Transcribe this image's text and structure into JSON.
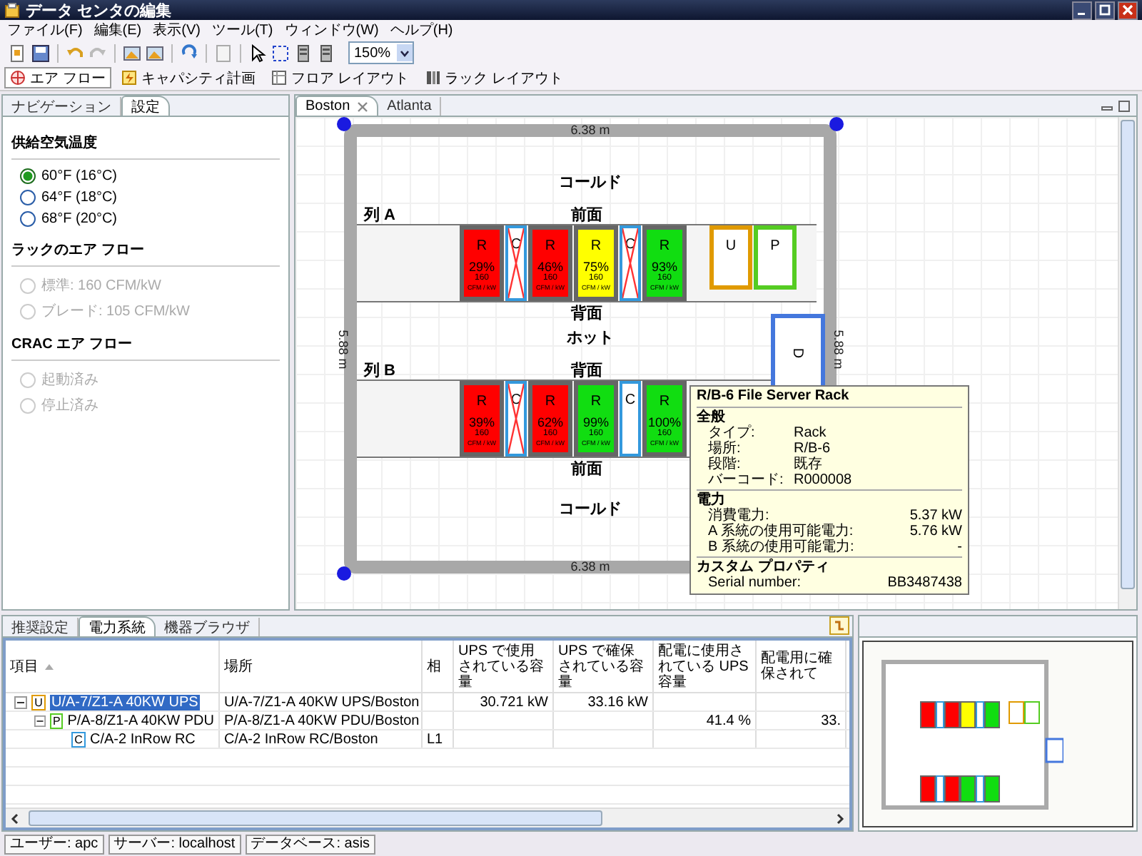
{
  "window": {
    "title": "データ センタの編集"
  },
  "menu": [
    "ファイル(F)",
    "編集(E)",
    "表示(V)",
    "ツール(T)",
    "ウィンドウ(W)",
    "ヘルプ(H)"
  ],
  "toolbar": {
    "zoom": "150%"
  },
  "perspectives": [
    {
      "label": "エア フロー",
      "selected": true
    },
    {
      "label": "キャパシティ計画",
      "selected": false
    },
    {
      "label": "フロア レイアウト",
      "selected": false
    },
    {
      "label": "ラック レイアウト",
      "selected": false
    }
  ],
  "left_panel": {
    "tabs": [
      {
        "label": "ナビゲーション",
        "selected": false
      },
      {
        "label": "設定",
        "selected": true
      }
    ],
    "sections": [
      {
        "title": "供給空気温度",
        "options": [
          {
            "label": "60°F (16°C)",
            "selected": true,
            "disabled": false
          },
          {
            "label": "64°F (18°C)",
            "selected": false,
            "disabled": false
          },
          {
            "label": "68°F (20°C)",
            "selected": false,
            "disabled": false
          }
        ]
      },
      {
        "title": "ラックのエア フロー",
        "options": [
          {
            "label": "標準: 160 CFM/kW",
            "selected": false,
            "disabled": true
          },
          {
            "label": "ブレード: 105 CFM/kW",
            "selected": false,
            "disabled": true
          }
        ]
      },
      {
        "title": "CRAC エア フロー",
        "options": [
          {
            "label": "起動済み",
            "selected": false,
            "disabled": true
          },
          {
            "label": "停止済み",
            "selected": false,
            "disabled": true
          }
        ]
      }
    ]
  },
  "editor": {
    "tabs": [
      {
        "label": "Boston",
        "selected": true,
        "closable": true
      },
      {
        "label": "Atlanta",
        "selected": false,
        "closable": false
      }
    ]
  },
  "floor_plan": {
    "width_top": "6.38 m",
    "width_bottom": "6.38 m",
    "depth_left": "5.88 m",
    "depth_right": "5.88 m",
    "layout": [
      {
        "kind": "aisle",
        "label": "コールド"
      },
      {
        "kind": "row",
        "label": "列 A",
        "top_label": "前面",
        "bottom_label": "背面",
        "units": [
          {
            "kind": "rack",
            "letter": "R",
            "percent": "29%",
            "airflow": "160",
            "airflow_unit": "CFM / kW",
            "color": "#ff0000"
          },
          {
            "kind": "cooler",
            "letter": "C",
            "disabled": true
          },
          {
            "kind": "rack",
            "letter": "R",
            "percent": "46%",
            "airflow": "160",
            "airflow_unit": "CFM / kW",
            "color": "#ff0000"
          },
          {
            "kind": "rack",
            "letter": "R",
            "percent": "75%",
            "airflow": "160",
            "airflow_unit": "CFM / kW",
            "color": "#ffff00"
          },
          {
            "kind": "cooler",
            "letter": "C",
            "disabled": true
          },
          {
            "kind": "rack",
            "letter": "R",
            "percent": "93%",
            "airflow": "160",
            "airflow_unit": "CFM / kW",
            "color": "#11dd11"
          },
          {
            "kind": "power",
            "letter": "U",
            "color": "#e09a00"
          },
          {
            "kind": "power",
            "letter": "P",
            "color": "#55cc22"
          }
        ]
      },
      {
        "kind": "aisle",
        "label": "ホット"
      },
      {
        "kind": "row",
        "label": "列 B",
        "top_label": "背面",
        "bottom_label": "前面",
        "units": [
          {
            "kind": "rack",
            "letter": "R",
            "percent": "39%",
            "airflow": "160",
            "airflow_unit": "CFM / kW",
            "color": "#ff0000"
          },
          {
            "kind": "cooler",
            "letter": "C",
            "disabled": true
          },
          {
            "kind": "rack",
            "letter": "R",
            "percent": "62%",
            "airflow": "160",
            "airflow_unit": "CFM / kW",
            "color": "#ff0000"
          },
          {
            "kind": "rack",
            "letter": "R",
            "percent": "99%",
            "airflow": "160",
            "airflow_unit": "CFM / kW",
            "color": "#11dd11"
          },
          {
            "kind": "cooler",
            "letter": "C",
            "disabled": false
          },
          {
            "kind": "rack",
            "letter": "R",
            "percent": "100%",
            "airflow": "160",
            "airflow_unit": "CFM / kW",
            "color": "#11dd11"
          }
        ]
      },
      {
        "kind": "aisle",
        "label": "コールド"
      }
    ],
    "extra_unit": {
      "letter": "D"
    }
  },
  "tooltip": {
    "title": "R/B-6 File Server Rack",
    "sections": [
      {
        "title": "全般",
        "rows": [
          {
            "label": "タイプ:",
            "value": "Rack"
          },
          {
            "label": "場所:",
            "value": "R/B-6"
          },
          {
            "label": "段階:",
            "value": "既存"
          },
          {
            "label": "バーコード:",
            "value": "R000008"
          }
        ]
      },
      {
        "title": "電力",
        "rows": [
          {
            "label": "消費電力:",
            "value": "5.37 kW"
          },
          {
            "label": "A 系統の使用可能電力:",
            "value": "5.76 kW"
          },
          {
            "label": "B 系統の使用可能電力:",
            "value": "-"
          }
        ]
      },
      {
        "title": "カスタム プロパティ",
        "rows": [
          {
            "label": "Serial number:",
            "value": "BB3487438"
          }
        ]
      }
    ]
  },
  "bottom": {
    "tabs": [
      {
        "label": "推奨設定",
        "selected": false
      },
      {
        "label": "電力系統",
        "selected": true
      },
      {
        "label": "機器ブラウザ",
        "selected": false
      }
    ],
    "table": {
      "columns": [
        "項目",
        "場所",
        "相",
        "UPS で使用されている容量",
        "UPS で確保されている容量",
        "配電に使用されている UPS 容量",
        "配電用に確保されて"
      ],
      "rows": [
        {
          "badge": "U",
          "color": "#e09a00",
          "name": "U/A-7/Z1-A 40KW UPS",
          "selected": true,
          "expanded": true,
          "location": "U/A-7/Z1-A 40KW UPS/Boston",
          "ups_used": "30.721 kW",
          "ups_reserved": "33.16 kW",
          "children": [
            {
              "badge": "P",
              "color": "#55cc22",
              "name": "P/A-8/Z1-A 40KW PDU",
              "selected": false,
              "expanded": true,
              "location": "P/A-8/Z1-A 40KW PDU/Boston",
              "dist_used": "41.4 %",
              "dist_reserved": "33.",
              "children": [
                {
                  "badge": "C",
                  "color": "#3399dd",
                  "name": "C/A-2 InRow RC",
                  "selected": false,
                  "location": "C/A-2 InRow RC/Boston",
                  "phase": "L1"
                }
              ]
            }
          ]
        }
      ]
    }
  },
  "status_bar": [
    "ユーザー: apc",
    "サーバー: localhost",
    "データベース: asis"
  ]
}
